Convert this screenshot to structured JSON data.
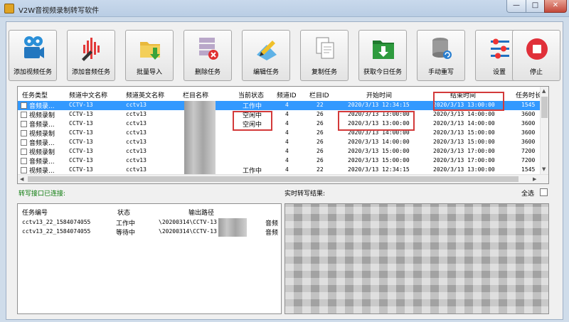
{
  "window": {
    "title": "V2W音视频录制转写软件",
    "min": "—",
    "max": "□",
    "close": "✕"
  },
  "toolbar": [
    {
      "label": "添加视频任务",
      "icon": "film-reel-icon"
    },
    {
      "label": "添加音频任务",
      "icon": "audio-wave-icon"
    },
    {
      "label": "批量导入",
      "icon": "folder-import-icon"
    },
    {
      "label": "删除任务",
      "icon": "delete-task-icon"
    },
    {
      "label": "编辑任务",
      "icon": "edit-task-icon"
    },
    {
      "label": "复制任务",
      "icon": "copy-task-icon"
    },
    {
      "label": "获取今日任务",
      "icon": "download-folder-icon"
    },
    {
      "label": "手动重写",
      "icon": "database-refresh-icon"
    },
    {
      "label": "设置",
      "icon": "settings-sliders-icon"
    },
    {
      "label": "停止",
      "icon": "stop-icon"
    }
  ],
  "task_grid": {
    "headers": [
      "任务类型",
      "频道中文名称",
      "频道英文名称",
      "栏目名称",
      "当前状态",
      "频道ID",
      "栏目ID",
      "开始时间",
      "结束时间",
      "任务时长"
    ],
    "rows": [
      {
        "type": "音频录...",
        "cn": "CCTV-13",
        "en": "cctv13",
        "status": "工作中",
        "ch": "4",
        "col": "22",
        "start": "2020/3/13 12:34:15",
        "end": "2020/3/13 13:00:00",
        "dur": "1545"
      },
      {
        "type": "视频录制",
        "cn": "CCTV-13",
        "en": "cctv13",
        "status": "空闲中",
        "ch": "4",
        "col": "26",
        "start": "2020/3/13 13:00:00",
        "end": "2020/3/13 14:00:00",
        "dur": "3600"
      },
      {
        "type": "音频录...",
        "cn": "CCTV-13",
        "en": "cctv13",
        "status": "空闲中",
        "ch": "4",
        "col": "26",
        "start": "2020/3/13 13:00:00",
        "end": "2020/3/13 14:00:00",
        "dur": "3600"
      },
      {
        "type": "视频录制",
        "cn": "CCTV-13",
        "en": "cctv13",
        "status": "",
        "ch": "4",
        "col": "26",
        "start": "2020/3/13 14:00:00",
        "end": "2020/3/13 15:00:00",
        "dur": "3600"
      },
      {
        "type": "音频录...",
        "cn": "CCTV-13",
        "en": "cctv13",
        "status": "",
        "ch": "4",
        "col": "26",
        "start": "2020/3/13 14:00:00",
        "end": "2020/3/13 15:00:00",
        "dur": "3600"
      },
      {
        "type": "视频录制",
        "cn": "CCTV-13",
        "en": "cctv13",
        "status": "",
        "ch": "4",
        "col": "26",
        "start": "2020/3/13 15:00:00",
        "end": "2020/3/13 17:00:00",
        "dur": "7200"
      },
      {
        "type": "音频录...",
        "cn": "CCTV-13",
        "en": "cctv13",
        "status": "",
        "ch": "4",
        "col": "26",
        "start": "2020/3/13 15:00:00",
        "end": "2020/3/13 17:00:00",
        "dur": "7200"
      },
      {
        "type": "视频录...",
        "cn": "CCTV-13",
        "en": "cctv13",
        "status": "工作中",
        "ch": "4",
        "col": "22",
        "start": "2020/3/13 12:34:15",
        "end": "2020/3/13 13:00:00",
        "dur": "1545"
      }
    ]
  },
  "labels": {
    "connected": "转写接口已连接:",
    "realtime": "实时转写结果:",
    "select_all": "全选"
  },
  "trans_grid": {
    "headers": [
      "任务编号",
      "状态",
      "输出路径"
    ],
    "rows": [
      {
        "id": "cctv13_22_1584074055",
        "status": "工作中",
        "path": "\\20200314\\CCTV-13",
        "extra": "音频"
      },
      {
        "id": "cctv13_22_1584074055",
        "status": "等待中",
        "path": "\\20200314\\CCTV-13",
        "extra": "音频"
      }
    ]
  },
  "colors": {
    "selection": "#3399ff",
    "highlight": "#d33a3a",
    "connected_text": "#0a7a0a"
  }
}
